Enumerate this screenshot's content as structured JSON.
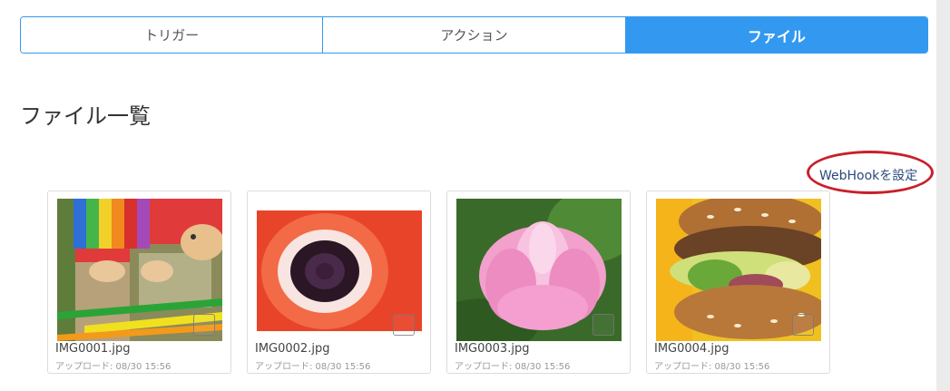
{
  "tabs": [
    {
      "label": "トリガー",
      "active": false
    },
    {
      "label": "アクション",
      "active": false
    },
    {
      "label": "ファイル",
      "active": true
    }
  ],
  "page_title": "ファイル一覧",
  "webhook_link": "WebHookを設定",
  "files": [
    {
      "name": "IMG0001.jpg",
      "uploaded": "アップロード: 08/30 15:56",
      "image": "toy-turtle-and-crayons-photo"
    },
    {
      "name": "IMG0002.jpg",
      "uploaded": "アップロード: 08/30 15:56",
      "image": "red-anemone-flower-photo"
    },
    {
      "name": "IMG0003.jpg",
      "uploaded": "アップロード: 08/30 15:56",
      "image": "pink-lotus-flower-photo"
    },
    {
      "name": "IMG0004.jpg",
      "uploaded": "アップロード: 08/30 15:56",
      "image": "burger-sandwich-photo"
    }
  ],
  "colors": {
    "accent": "#3399f0",
    "annotation": "#c8202a",
    "link": "#2a4a7a"
  }
}
